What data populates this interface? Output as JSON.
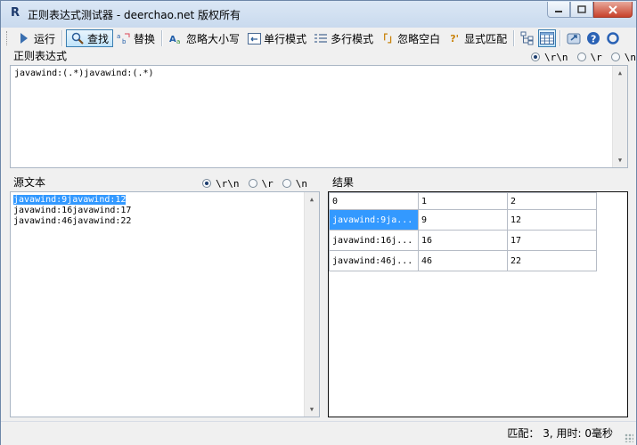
{
  "window": {
    "title": "正则表达式测试器 - deerchao.net 版权所有",
    "app_icon": "R"
  },
  "toolbar": {
    "run": "运行",
    "find": "查找",
    "replace": "替换",
    "ignore_case": "忽略大小写",
    "single_line": "单行模式",
    "multi_line": "多行模式",
    "ignore_whitespace": "忽略空白",
    "explicit_capture": "显式匹配"
  },
  "regex_panel": {
    "label": "正则表达式",
    "options": [
      "\\r\\n",
      "\\r",
      "\\n"
    ],
    "selected": 0,
    "value": "javawind:(.*)javawind:(.*)"
  },
  "source_panel": {
    "label": "源文本",
    "options": [
      "\\r\\n",
      "\\r",
      "\\n"
    ],
    "selected": 0,
    "lines": [
      "javawind:9javawind:12",
      "javawind:16javawind:17",
      "javawind:46javawind:22"
    ]
  },
  "result_panel": {
    "label": "结果",
    "columns": [
      "0",
      "1",
      "2"
    ],
    "rows": [
      [
        "javawind:9ja...",
        "9",
        "12"
      ],
      [
        "javawind:16j...",
        "16",
        "17"
      ],
      [
        "javawind:46j...",
        "46",
        "22"
      ]
    ]
  },
  "status": {
    "text": "匹配： 3, 用时: 0毫秒"
  },
  "colors": {
    "selection": "#3399ff",
    "window_bg": "#f0f0f0",
    "titlebar": "#c9daee"
  }
}
